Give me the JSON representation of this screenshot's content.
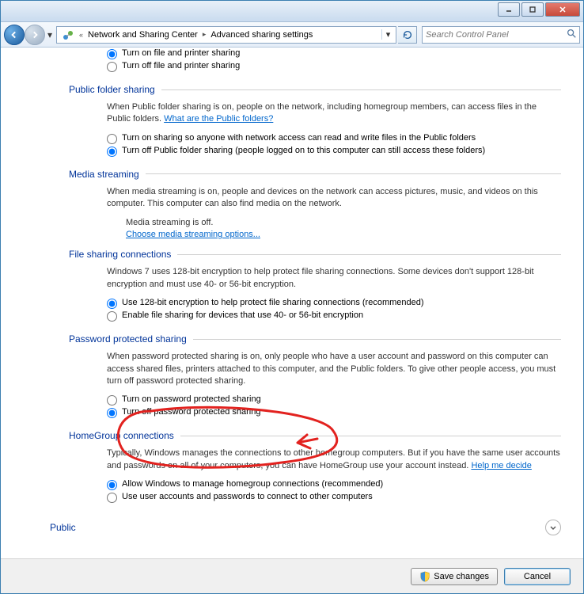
{
  "titlebar": {},
  "nav": {
    "breadcrumb": [
      {
        "label": "Network and Sharing Center"
      },
      {
        "label": "Advanced sharing settings"
      }
    ],
    "search_placeholder": "Search Control Panel"
  },
  "sections": {
    "file_printer": {
      "opt_on": "Turn on file and printer sharing",
      "opt_off": "Turn off file and printer sharing"
    },
    "public_folder": {
      "title": "Public folder sharing",
      "desc": "When Public folder sharing is on, people on the network, including homegroup members, can access files in the Public folders.",
      "link": "What are the Public folders?",
      "opt_on": "Turn on sharing so anyone with network access can read and write files in the Public folders",
      "opt_off": "Turn off Public folder sharing (people logged on to this computer can still access these folders)"
    },
    "media": {
      "title": "Media streaming",
      "desc": "When media streaming is on, people and devices on the network can access pictures, music, and videos on this computer. This computer can also find media on the network.",
      "status": "Media streaming is off.",
      "link": "Choose media streaming options..."
    },
    "file_conn": {
      "title": "File sharing connections",
      "desc": "Windows 7 uses 128-bit encryption to help protect file sharing connections. Some devices don't support 128-bit encryption and must use 40- or 56-bit encryption.",
      "opt_on": "Use 128-bit encryption to help protect file sharing connections (recommended)",
      "opt_off": "Enable file sharing for devices that use 40- or 56-bit encryption"
    },
    "password": {
      "title": "Password protected sharing",
      "desc": "When password protected sharing is on, only people who have a user account and password on this computer can access shared files, printers attached to this computer, and the Public folders. To give other people access, you must turn off password protected sharing.",
      "opt_on": "Turn on password protected sharing",
      "opt_off": "Turn off password protected sharing"
    },
    "homegroup": {
      "title": "HomeGroup connections",
      "desc": "Typically, Windows manages the connections to other homegroup computers. But if you have the same user accounts and passwords on all of your computers, you can have HomeGroup use your account instead.",
      "link": "Help me decide",
      "opt_on": "Allow Windows to manage homegroup connections (recommended)",
      "opt_off": "Use user accounts and passwords to connect to other computers"
    }
  },
  "profile": {
    "label": "Public"
  },
  "footer": {
    "save": "Save changes",
    "cancel": "Cancel"
  }
}
